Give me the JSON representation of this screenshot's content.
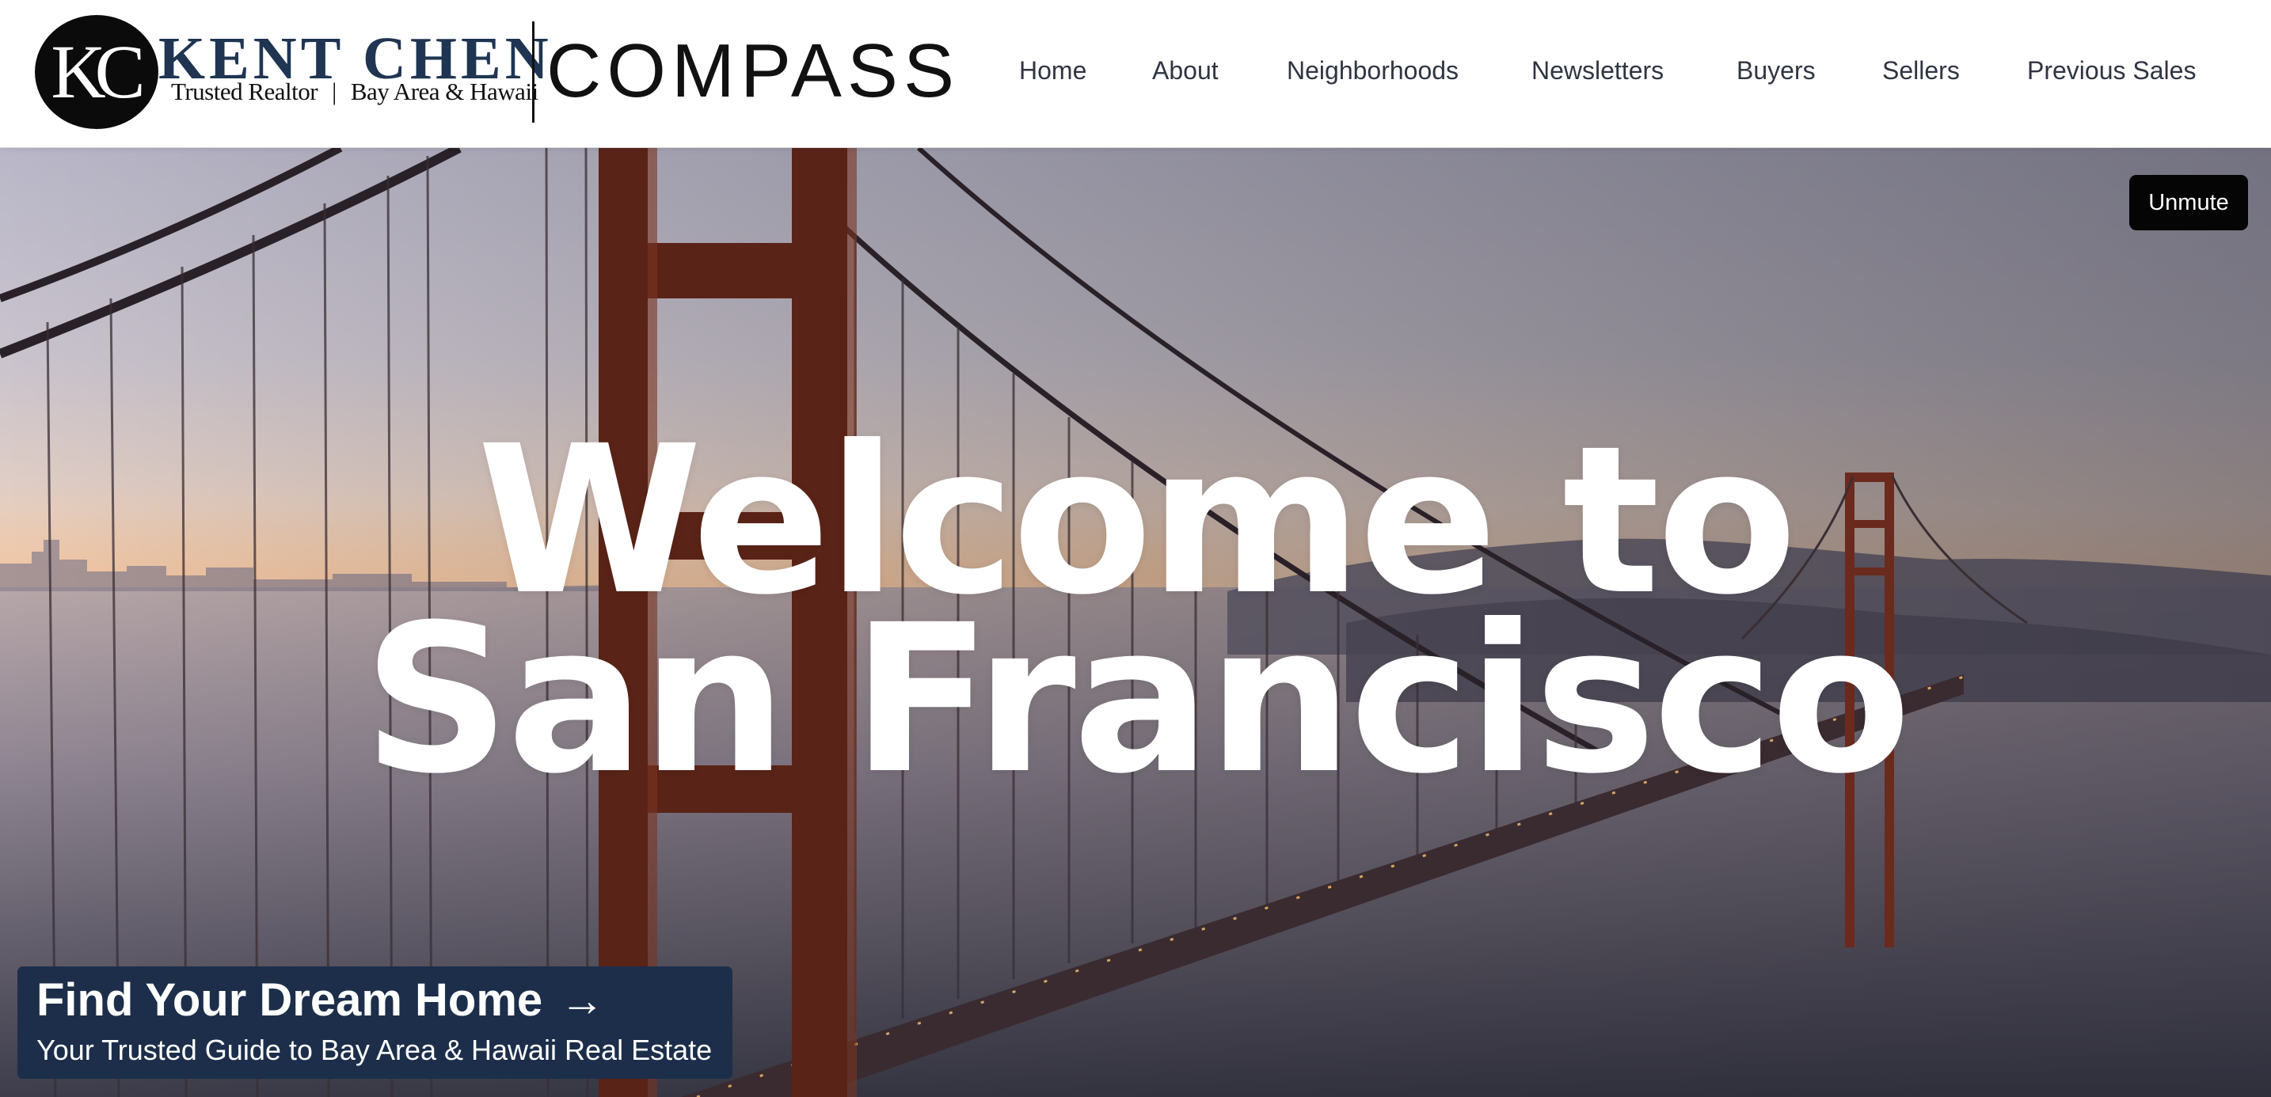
{
  "header": {
    "logo": {
      "monogram": "KC",
      "name": "KENT CHEN",
      "tagline_left": "Trusted Realtor",
      "tagline_separator": "|",
      "tagline_right": "Bay Area & Hawaii"
    },
    "brokerage": "COMPASS",
    "nav": [
      {
        "label": "Home"
      },
      {
        "label": "About"
      },
      {
        "label": "Neighborhoods"
      },
      {
        "label": "Newsletters"
      },
      {
        "label": "Buyers"
      },
      {
        "label": "Sellers"
      },
      {
        "label": "Previous Sales"
      }
    ]
  },
  "hero": {
    "title_line1": "Welcome to",
    "title_line2": "San Francisco",
    "unmute_label": "Unmute",
    "cta": {
      "title": "Find Your Dream Home",
      "arrow_icon": "arrow-right-icon",
      "subtitle": "Your Trusted Guide to Bay Area & Hawaii Real Estate"
    }
  },
  "colors": {
    "brand_navy": "#1c2e4a",
    "logo_name": "#1f3552",
    "nav_text": "#2f3542",
    "button_black": "#050505",
    "bridge_red": "#6b2a1e"
  }
}
